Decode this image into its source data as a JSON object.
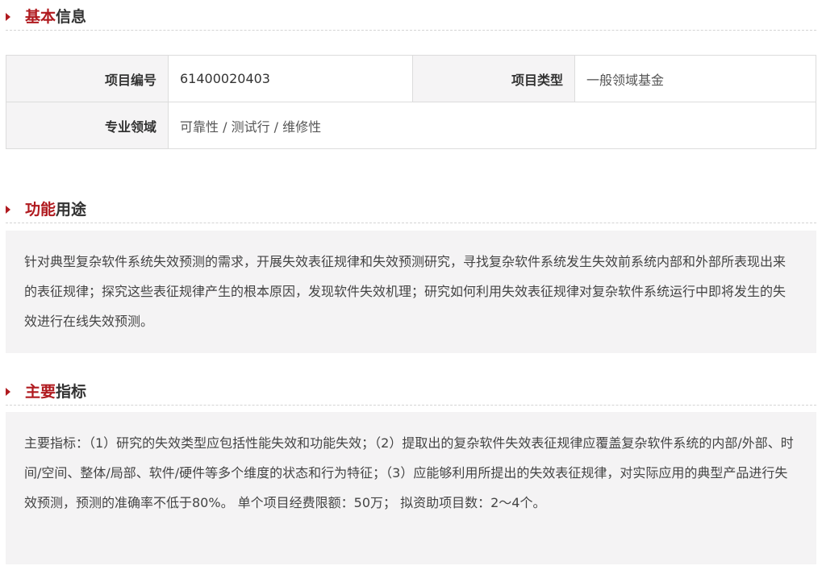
{
  "basic": {
    "title_red": "基本",
    "title_dark": "信息",
    "rows": [
      {
        "label1": "项目编号",
        "value1": "61400020403",
        "label2": "项目类型",
        "value2": "一般领域基金"
      },
      {
        "label1": "专业领域",
        "value1": "可靠性 / 测试行 / 维修性"
      }
    ]
  },
  "function": {
    "title_red": "功能",
    "title_dark": "用途",
    "text": "针对典型复杂软件系统失效预测的需求，开展失效表征规律和失效预测研究，寻找复杂软件系统发生失效前系统内部和外部所表现出来的表征规律；探究这些表征规律产生的根本原因，发现软件失效机理；研究如何利用失效表征规律对复杂软件系统运行中即将发生的失效进行在线失效预测。"
  },
  "indicators": {
    "title_red": "主要",
    "title_dark": "指标",
    "text": "主要指标：（1）研究的失效类型应包括性能失效和功能失效；（2）提取出的复杂软件失效表征规律应覆盖复杂软件系统的内部/外部、时间/空间、整体/局部、软件/硬件等多个维度的状态和行为特征；（3）应能够利用所提出的失效表征规律，对实际应用的典型产品进行失效预测，预测的准确率不低于80%。 单个项目经费限额：50万； 拟资助项目数：2～4个。"
  },
  "colors": {
    "accent": "#b01a1f",
    "label_bg": "#f5f4f5",
    "box_bg": "#f4f3f4"
  }
}
